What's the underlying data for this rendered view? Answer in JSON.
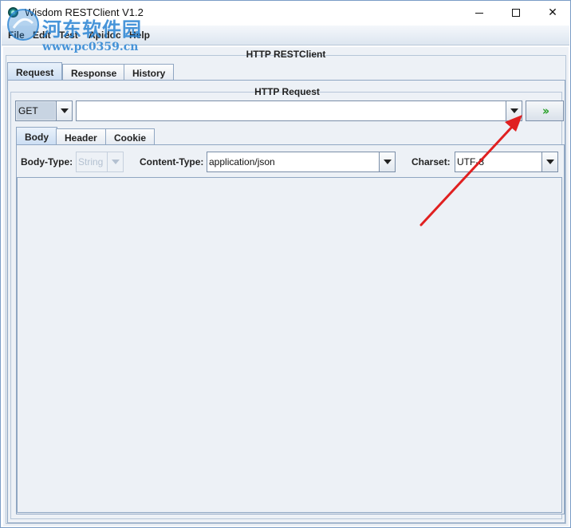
{
  "window": {
    "title": "Wisdom RESTClient V1.2",
    "minimize_label": "—",
    "maximize_label": "☐",
    "close_label": "✕"
  },
  "menu": {
    "items": [
      "File",
      "Edit",
      "Test",
      "Apidoc",
      "Help"
    ]
  },
  "watermark": {
    "text": "河东软件园",
    "url": "www.pc0359.cn"
  },
  "main": {
    "group_title": "HTTP RESTClient",
    "tabs": [
      "Request",
      "Response",
      "History"
    ],
    "active_tab": "Request"
  },
  "request": {
    "group_title": "HTTP Request",
    "method": "GET",
    "url_value": "",
    "send_label": "»",
    "tabs": [
      "Body",
      "Header",
      "Cookie"
    ],
    "active_tab": "Body",
    "body_type_label": "Body-Type:",
    "body_type_value": "String",
    "content_type_label": "Content-Type:",
    "content_type_value": "application/json",
    "charset_label": "Charset:",
    "charset_value": "UTF-8",
    "body_text": ""
  },
  "annotation": {
    "arrow_color": "#e02020"
  }
}
